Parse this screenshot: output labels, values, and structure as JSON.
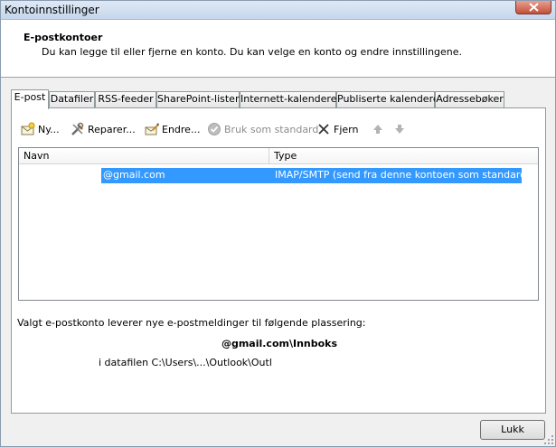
{
  "window": {
    "title": "Kontoinnstillinger"
  },
  "header": {
    "title": "E-postkontoer",
    "description": "Du kan legge til eller fjerne en konto. Du kan velge en konto og endre innstillingene."
  },
  "tabs": [
    {
      "label": "E-post",
      "active": true
    },
    {
      "label": "Datafiler"
    },
    {
      "label": "RSS-feeder"
    },
    {
      "label": "SharePoint-lister"
    },
    {
      "label": "Internett-kalendere"
    },
    {
      "label": "Publiserte kalendere"
    },
    {
      "label": "Adressebøker"
    }
  ],
  "toolbar": {
    "new_label": "Ny...",
    "repair_label": "Reparer...",
    "change_label": "Endre...",
    "default_label": "Bruk som standard",
    "remove_label": "Fjern"
  },
  "list": {
    "columns": [
      "Navn",
      "Type"
    ],
    "rows": [
      {
        "name": "@gmail.com",
        "type": "IMAP/SMTP (send fra denne kontoen som standard)",
        "selected": true
      }
    ]
  },
  "delivery": {
    "text": "Valgt e-postkonto leverer nye e-postmeldinger til følgende plassering:",
    "location": "@gmail.com\\Innboks",
    "datafile": "i datafilen C:\\Users\\...\\Outlook\\Outl"
  },
  "footer": {
    "close_label": "Lukk"
  },
  "colors": {
    "selection": "#3399ff",
    "disabled_text": "#8c8c8c"
  }
}
